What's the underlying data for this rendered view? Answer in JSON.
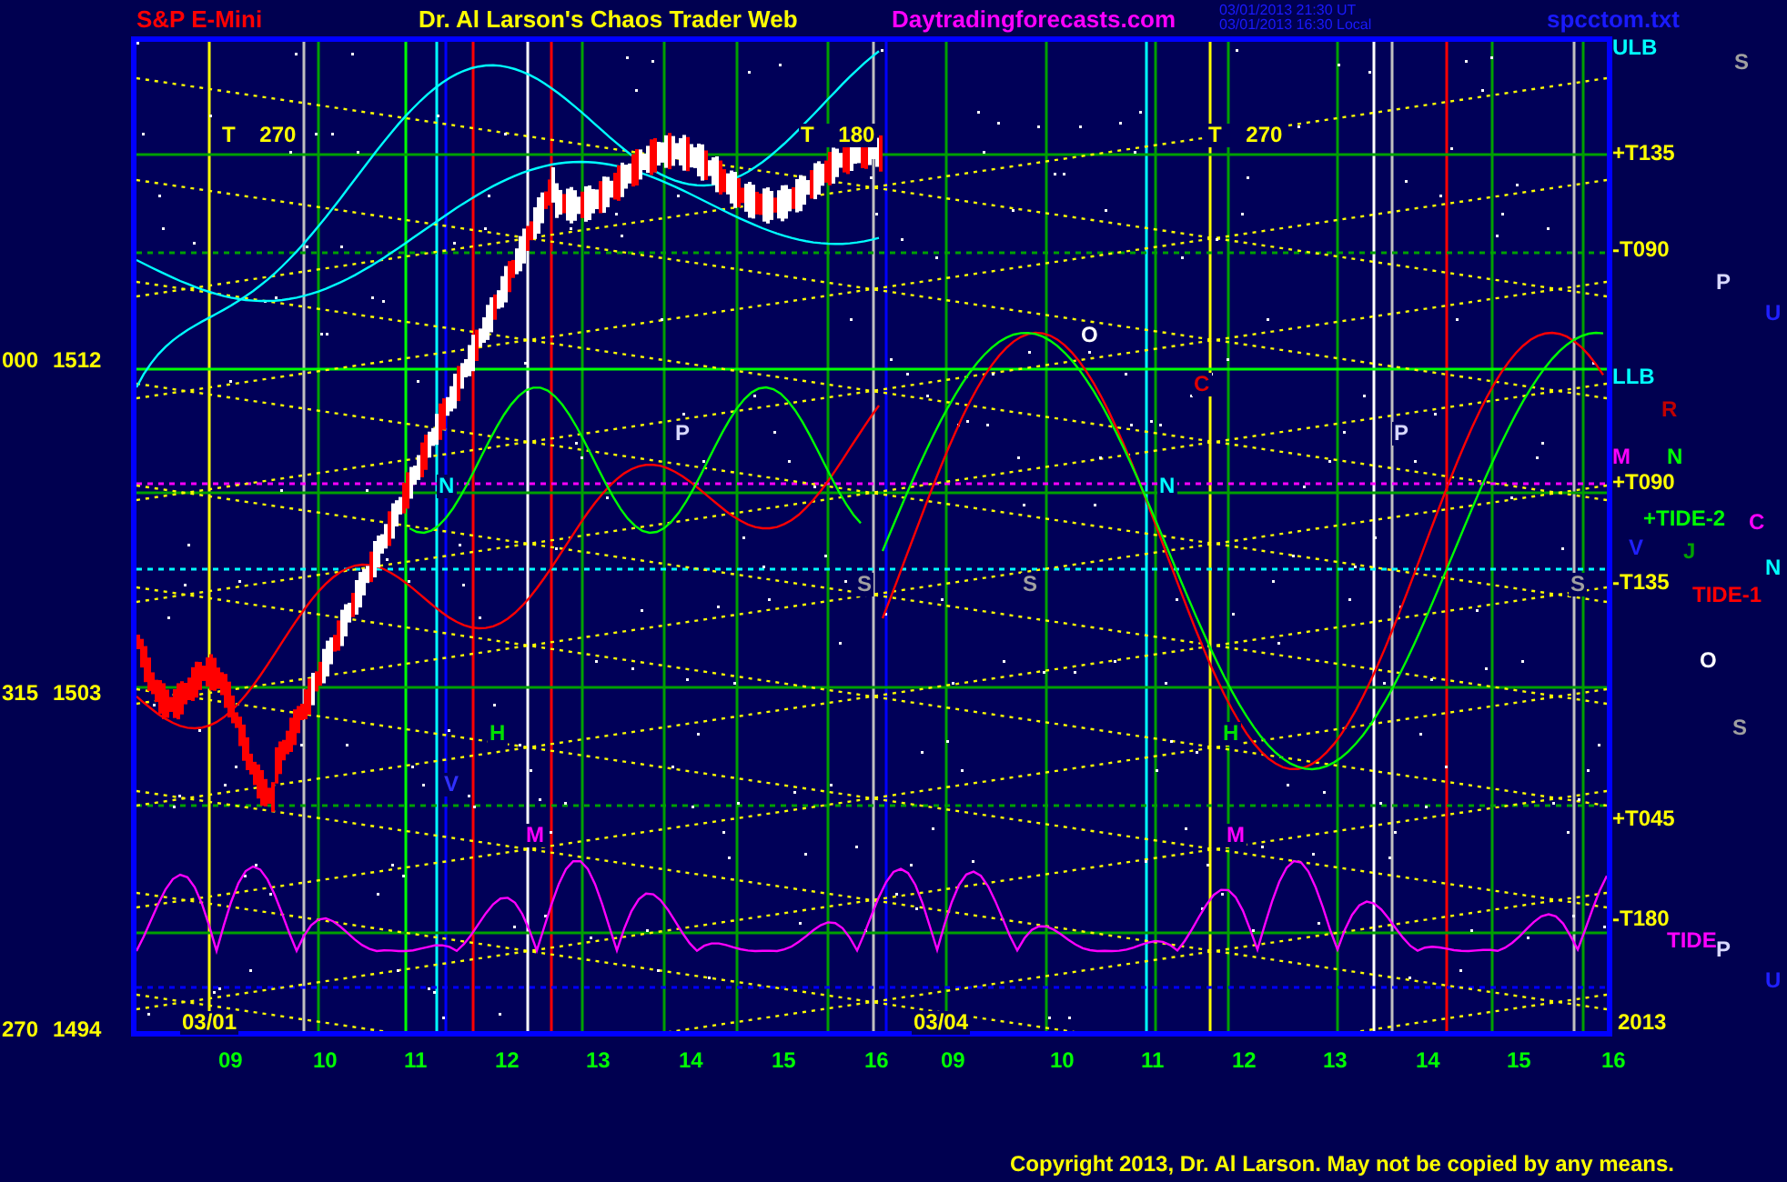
{
  "header": {
    "instrument": "S&P E-Mini",
    "site_title": "Dr. Al Larson's Chaos Trader Web",
    "website": "Daytradingforecasts.com",
    "timestamps": [
      "03/01/2013 21:30 UT",
      "03/01/2013 16:30 Local"
    ],
    "filename": "spcctom.txt"
  },
  "left_axis": [
    {
      "angle": "000",
      "price": "1512"
    },
    {
      "angle": "315",
      "price": "1503"
    },
    {
      "angle": "270",
      "price": "1494"
    }
  ],
  "chart_labels": [
    {
      "text": "T 270",
      "color": "#ffff00"
    },
    {
      "text": "T 180",
      "color": "#ffff00"
    },
    {
      "text": "T 270",
      "color": "#ffff00"
    },
    {
      "text": "O",
      "color": "#ffffff"
    },
    {
      "text": "C",
      "color": "#e00000"
    },
    {
      "text": "P",
      "color": "#d8d8ff"
    },
    {
      "text": "P",
      "color": "#d8d8ff"
    },
    {
      "text": "N",
      "color": "#00ffff"
    },
    {
      "text": "N",
      "color": "#00ffff"
    },
    {
      "text": "S",
      "color": "#a0a0a0"
    },
    {
      "text": "S",
      "color": "#a0a0a0"
    },
    {
      "text": "S",
      "color": "#a0a0a0"
    },
    {
      "text": "H",
      "color": "#00e000"
    },
    {
      "text": "H",
      "color": "#00e000"
    },
    {
      "text": "V",
      "color": "#3030ff"
    },
    {
      "text": "M",
      "color": "#ff00ff"
    },
    {
      "text": "M",
      "color": "#ff00ff"
    },
    {
      "text": "03/01",
      "color": "#ffff00"
    },
    {
      "text": "03/04",
      "color": "#ffff00"
    }
  ],
  "right_labels": [
    {
      "text": "ULB",
      "color": "#00ffff"
    },
    {
      "text": "+T135",
      "color": "#ffff00"
    },
    {
      "text": "-T090",
      "color": "#ffff00"
    },
    {
      "text": "LLB",
      "color": "#00ffff"
    },
    {
      "text": "+T090",
      "color": "#ffff00"
    },
    {
      "text": "-T135",
      "color": "#ffff00"
    },
    {
      "text": "+T045",
      "color": "#ffff00"
    },
    {
      "text": "-T180",
      "color": "#ffff00"
    },
    {
      "text": "2013",
      "color": "#ffff00"
    },
    {
      "text": "S",
      "color": "#a0a0a0"
    },
    {
      "text": "P",
      "color": "#d8d8ff"
    },
    {
      "text": "U",
      "color": "#2020ff"
    },
    {
      "text": "R",
      "color": "#c00000"
    },
    {
      "text": "M",
      "color": "#ff00ff"
    },
    {
      "text": "N",
      "color": "#00ff00"
    },
    {
      "text": "+TIDE-2",
      "color": "#00ff00"
    },
    {
      "text": "V",
      "color": "#2020ff"
    },
    {
      "text": "J",
      "color": "#00a000"
    },
    {
      "text": "C",
      "color": "#ff00ff"
    },
    {
      "text": "N",
      "color": "#00ffff"
    },
    {
      "text": "TIDE-1",
      "color": "#ff0000"
    },
    {
      "text": "O",
      "color": "#ffffff"
    },
    {
      "text": "S",
      "color": "#a0a0a0"
    },
    {
      "text": "TIDE",
      "color": "#ff00ff"
    },
    {
      "text": "P",
      "color": "#d8d8ff"
    },
    {
      "text": "U",
      "color": "#2020ff"
    }
  ],
  "hour_axis": [
    "09",
    "10",
    "11",
    "12",
    "13",
    "14",
    "15",
    "16",
    "09",
    "10",
    "11",
    "12",
    "13",
    "14",
    "15",
    "16"
  ],
  "footer": {
    "copyright": "Copyright 2013, Dr. Al Larson. May not be copied by any means."
  }
}
